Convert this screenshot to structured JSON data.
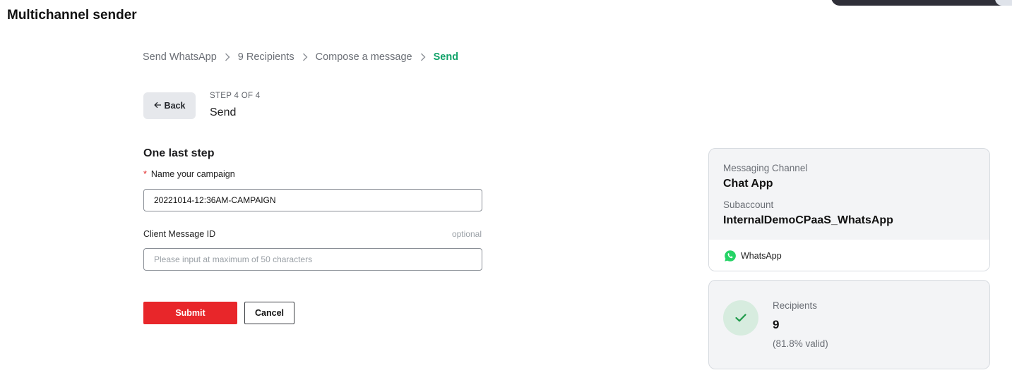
{
  "app": {
    "title": "Multichannel sender"
  },
  "breadcrumb": {
    "items": [
      {
        "label": "Send WhatsApp"
      },
      {
        "label": "9 Recipients"
      },
      {
        "label": "Compose a message"
      },
      {
        "label": "Send",
        "current": true
      }
    ],
    "accent_color": "#12a36a"
  },
  "step": {
    "back_label": "Back",
    "progress": "STEP 4 OF 4",
    "title": "Send"
  },
  "form": {
    "section_title": "One last step",
    "campaign_name": {
      "label": "Name your campaign",
      "required_marker": "*",
      "value": "20221014-12:36AM-CAMPAIGN"
    },
    "client_message_id": {
      "label": "Client Message ID",
      "optional_text": "optional",
      "value": "",
      "placeholder": "Please input at maximum of 50 characters"
    },
    "submit_label": "Submit",
    "cancel_label": "Cancel",
    "submit_color": "#e8262a"
  },
  "summary": {
    "channel": {
      "messaging_channel_label": "Messaging Channel",
      "messaging_channel_value": "Chat App",
      "subaccount_label": "Subaccount",
      "subaccount_value": "InternalDemoCPaaS_WhatsApp",
      "channel_name": "WhatsApp",
      "channel_icon": "whatsapp-icon",
      "channel_icon_color": "#25d366"
    },
    "recipients": {
      "label": "Recipients",
      "count": "9",
      "valid_text": "(81.8% valid)",
      "status_icon": "check-icon",
      "status_color": "#1f9a4a"
    }
  }
}
